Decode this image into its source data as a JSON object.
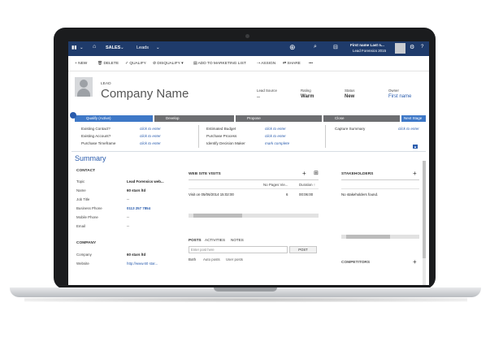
{
  "topbar": {
    "module": "SALES",
    "area": "Leads",
    "user_name": "First name Last n...",
    "user_org": "Lead Forensics 2015"
  },
  "toolbar": {
    "new": "NEW",
    "delete": "DELETE",
    "qualify": "QUALIFY",
    "disqualify": "DISQUALIFY",
    "add_to_marketing": "ADD TO MARKETING LIST",
    "assign": "ASSIGN",
    "share": "SHARE",
    "more": "•••"
  },
  "header": {
    "entity": "LEAD",
    "name": "Company Name",
    "fields": [
      {
        "label": "Lead Source",
        "value": "--"
      },
      {
        "label": "Rating",
        "value": "Warm"
      },
      {
        "label": "Status",
        "value": "New"
      },
      {
        "label": "Owner",
        "value": "First name"
      }
    ]
  },
  "stages": {
    "items": [
      "Qualify (Active)",
      "Develop",
      "Propose",
      "Close"
    ],
    "next": "Next Stage"
  },
  "process": {
    "col1": [
      {
        "label": "Existing Contact?",
        "value": "click to enter"
      },
      {
        "label": "Existing Account?",
        "value": "click to enter"
      },
      {
        "label": "Purchase Timeframe",
        "value": "click to enter"
      }
    ],
    "col2": [
      {
        "label": "Estimated Budget",
        "value": "click to enter"
      },
      {
        "label": "Purchase Process",
        "value": "click to enter"
      },
      {
        "label": "Identify Decision Maker",
        "value": "mark complete"
      }
    ],
    "col3": [
      {
        "label": "Capture Summary",
        "value": "click to enter"
      }
    ]
  },
  "summary": {
    "title": "Summary",
    "contact_title": "CONTACT",
    "contact": [
      {
        "label": "Topic",
        "value": "Lead Forensics web..."
      },
      {
        "label": "Name",
        "value": "60 stars ltd"
      },
      {
        "label": "Job Title",
        "value": "--"
      },
      {
        "label": "Business Phone",
        "value": "0113 257 7854"
      },
      {
        "label": "Mobile Phone",
        "value": "--"
      },
      {
        "label": "Email",
        "value": "--"
      }
    ],
    "company_title": "COMPANY",
    "company": [
      {
        "label": "Company",
        "value": "60 stars ltd"
      },
      {
        "label": "Website",
        "value": "http://www.60 star..."
      }
    ]
  },
  "web": {
    "title": "WEB SITE VISITS",
    "columns": [
      "",
      "No Pages Vie...",
      "Duration ↑"
    ],
    "row": [
      "Visit on 05/06/2014 15:02:00",
      "6",
      "00:06:00"
    ]
  },
  "posts": {
    "tabs": [
      "POSTS",
      "ACTIVITIES",
      "NOTES"
    ],
    "placeholder": "Enter post here",
    "post_button": "POST",
    "filters": [
      "Both",
      "Auto posts",
      "User posts"
    ]
  },
  "stakeholders": {
    "title": "STAKEHOLDERS",
    "empty": "No stakeholders found.",
    "competitors": "COMPETITORS"
  },
  "colors": {
    "nav": "#1f3b6b",
    "accent": "#2a5cad",
    "stage_active": "#3e78c7"
  }
}
